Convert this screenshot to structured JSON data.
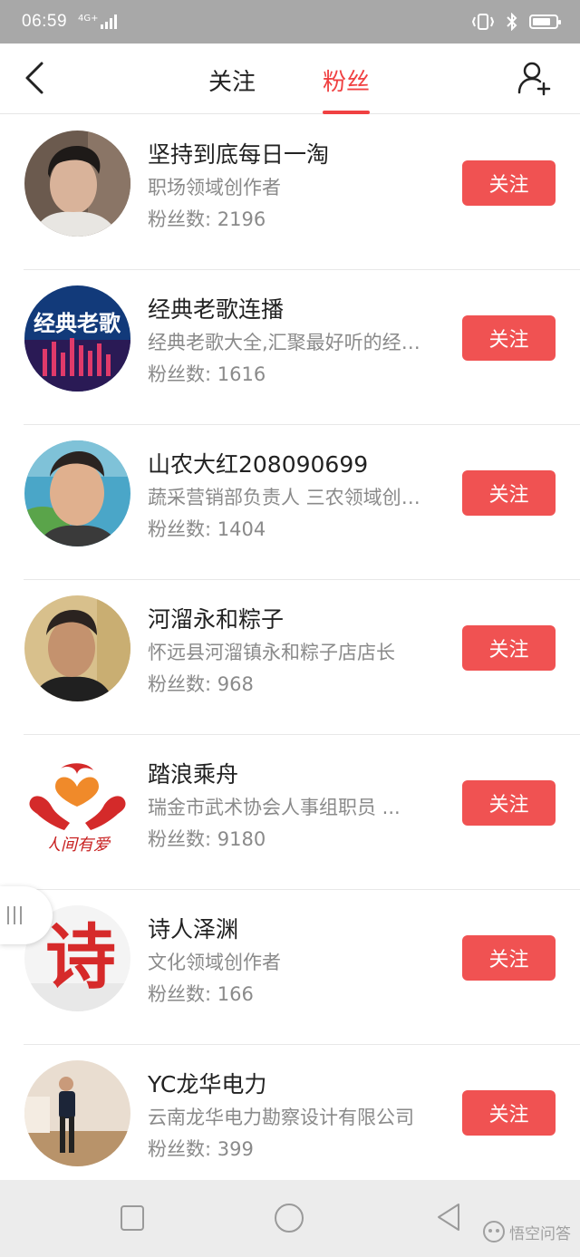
{
  "status_bar": {
    "time": "06:59",
    "network": "4G+"
  },
  "header": {
    "tabs": [
      {
        "label": "关注",
        "active": false
      },
      {
        "label": "粉丝",
        "active": true
      }
    ],
    "accent_color": "#f04142"
  },
  "followers": [
    {
      "name": "坚持到底每日一淘",
      "description": "职场领域创作者",
      "fans": "粉丝数: 2196",
      "button": "关注"
    },
    {
      "name": "经典老歌连播",
      "description": "经典老歌大全,汇聚最好听的经典老歌",
      "fans": "粉丝数: 1616",
      "button": "关注",
      "avatar_text": "经典老歌"
    },
    {
      "name": "山农大红208090699",
      "description": "蔬采营销部负责人 三农领域创作者",
      "fans": "粉丝数: 1404",
      "button": "关注"
    },
    {
      "name": "河溜永和粽子",
      "description": "怀远县河溜镇永和粽子店店长",
      "fans": "粉丝数: 968",
      "button": "关注"
    },
    {
      "name": "踏浪乘舟",
      "description": "瑞金市武术协会人事组职员 ...",
      "fans": "粉丝数: 9180",
      "button": "关注",
      "avatar_text": "人间有爱"
    },
    {
      "name": "诗人泽渊",
      "description": "文化领域创作者",
      "fans": "粉丝数: 166",
      "button": "关注",
      "avatar_text": "诗"
    },
    {
      "name": "YC龙华电力",
      "description": "云南龙华电力勘察设计有限公司",
      "fans": "粉丝数: 399",
      "button": "关注"
    }
  ],
  "follow_button_color": "#f05252",
  "watermark": "悟空问答"
}
